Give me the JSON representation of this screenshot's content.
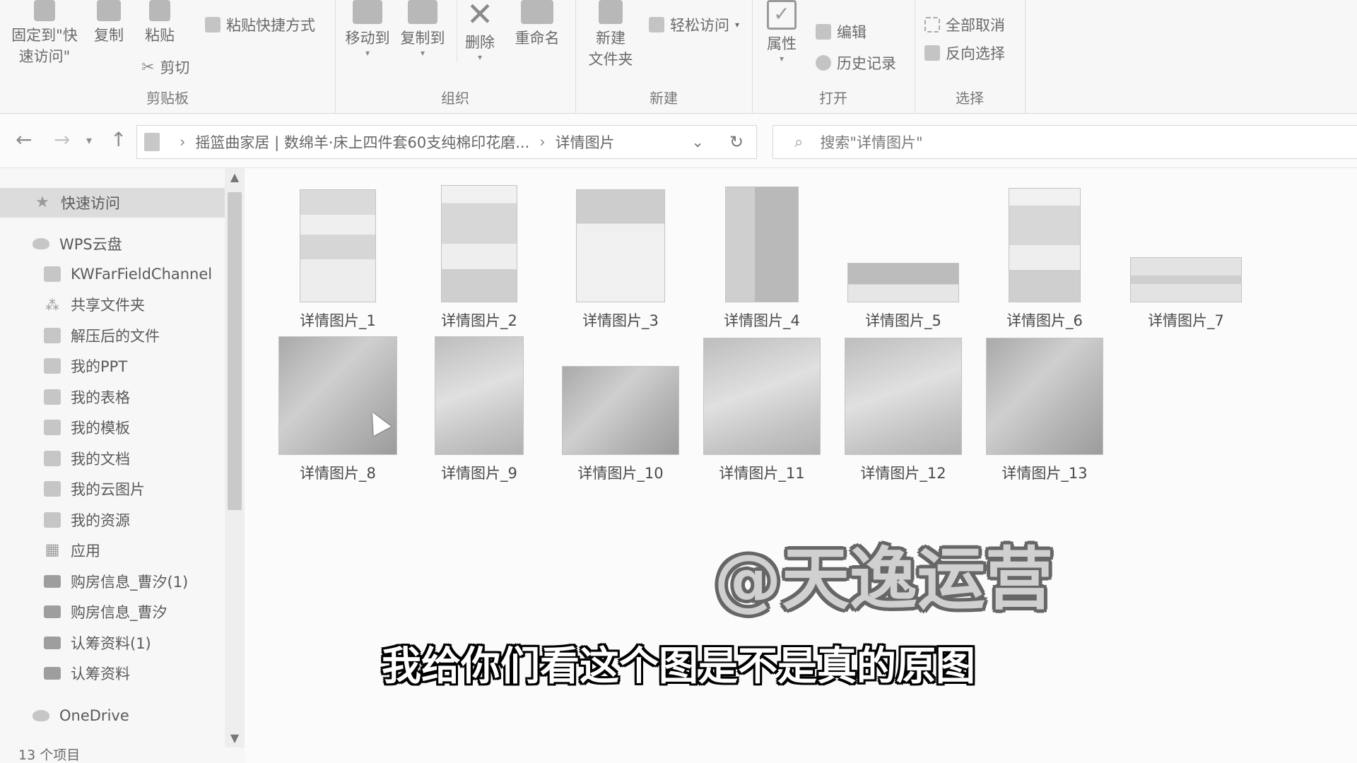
{
  "ribbon": {
    "clipboard": {
      "pin_label_line1": "固定到\"快",
      "pin_label_line2": "速访问\"",
      "copy_label": "复制",
      "paste_label": "粘贴",
      "paste_shortcut_label": "粘贴快捷方式",
      "cut_label": "剪切",
      "group_label": "剪贴板"
    },
    "organize": {
      "move_to_label": "移动到",
      "copy_to_label": "复制到",
      "delete_label": "删除",
      "rename_label": "重命名",
      "group_label": "组织"
    },
    "new": {
      "new_folder_line1": "新建",
      "new_folder_line2": "文件夹",
      "easy_access_label": "轻松访问",
      "group_label": "新建"
    },
    "open": {
      "properties_label": "属性",
      "edit_label": "编辑",
      "history_label": "历史记录",
      "group_label": "打开"
    },
    "select": {
      "select_none_label": "全部取消",
      "invert_selection_label": "反向选择",
      "group_label": "选择"
    }
  },
  "address_bar": {
    "path_parent": "摇篮曲家居 | 数绵羊·床上四件套60支纯棉印花磨...",
    "path_current": "详情图片",
    "search_placeholder": "搜索\"详情图片\""
  },
  "sidebar": {
    "items": [
      {
        "label": "快速访问",
        "icon": "star-icon"
      },
      {
        "label": "WPS云盘",
        "icon": "cloud-icon"
      },
      {
        "label": "KWFarFieldChannel",
        "icon": "folder-icon"
      },
      {
        "label": "共享文件夹",
        "icon": "share-icon"
      },
      {
        "label": "解压后的文件",
        "icon": "folder-icon"
      },
      {
        "label": "我的PPT",
        "icon": "folder-icon"
      },
      {
        "label": "我的表格",
        "icon": "folder-icon"
      },
      {
        "label": "我的模板",
        "icon": "folder-icon"
      },
      {
        "label": "我的文档",
        "icon": "folder-icon"
      },
      {
        "label": "我的云图片",
        "icon": "folder-icon"
      },
      {
        "label": "我的资源",
        "icon": "folder-icon"
      },
      {
        "label": "应用",
        "icon": "apps-icon"
      },
      {
        "label": "购房信息_曹汐(1)",
        "icon": "folder-icon"
      },
      {
        "label": "购房信息_曹汐",
        "icon": "folder-icon"
      },
      {
        "label": "认筹资料(1)",
        "icon": "folder-icon"
      },
      {
        "label": "认筹资料",
        "icon": "folder-icon"
      },
      {
        "label": "OneDrive",
        "icon": "cloud-icon"
      }
    ]
  },
  "status": {
    "item_count": "13 个项目"
  },
  "files": [
    {
      "name": "详情图片_1"
    },
    {
      "name": "详情图片_2"
    },
    {
      "name": "详情图片_3"
    },
    {
      "name": "详情图片_4"
    },
    {
      "name": "详情图片_5"
    },
    {
      "name": "详情图片_6"
    },
    {
      "name": "详情图片_7"
    },
    {
      "name": "详情图片_8"
    },
    {
      "name": "详情图片_9"
    },
    {
      "name": "详情图片_10"
    },
    {
      "name": "详情图片_11"
    },
    {
      "name": "详情图片_12"
    },
    {
      "name": "详情图片_13"
    }
  ],
  "overlay": {
    "watermark": "@天逸运营",
    "subtitle": "我给你们看这个图是不是真的原图"
  }
}
